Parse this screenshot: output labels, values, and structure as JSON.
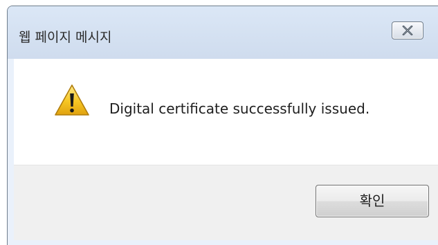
{
  "dialog": {
    "title": "웹 페이지 메시지",
    "message": "Digital certificate successfully issued.",
    "icon": "warning-icon",
    "ok_label": "확인",
    "close_icon": "close-icon"
  },
  "colors": {
    "titlebar": "#cfdcee",
    "button_area": "#f0f0f0",
    "warning_fill": "#f6c623",
    "warning_mark": "#1a1a1a"
  }
}
